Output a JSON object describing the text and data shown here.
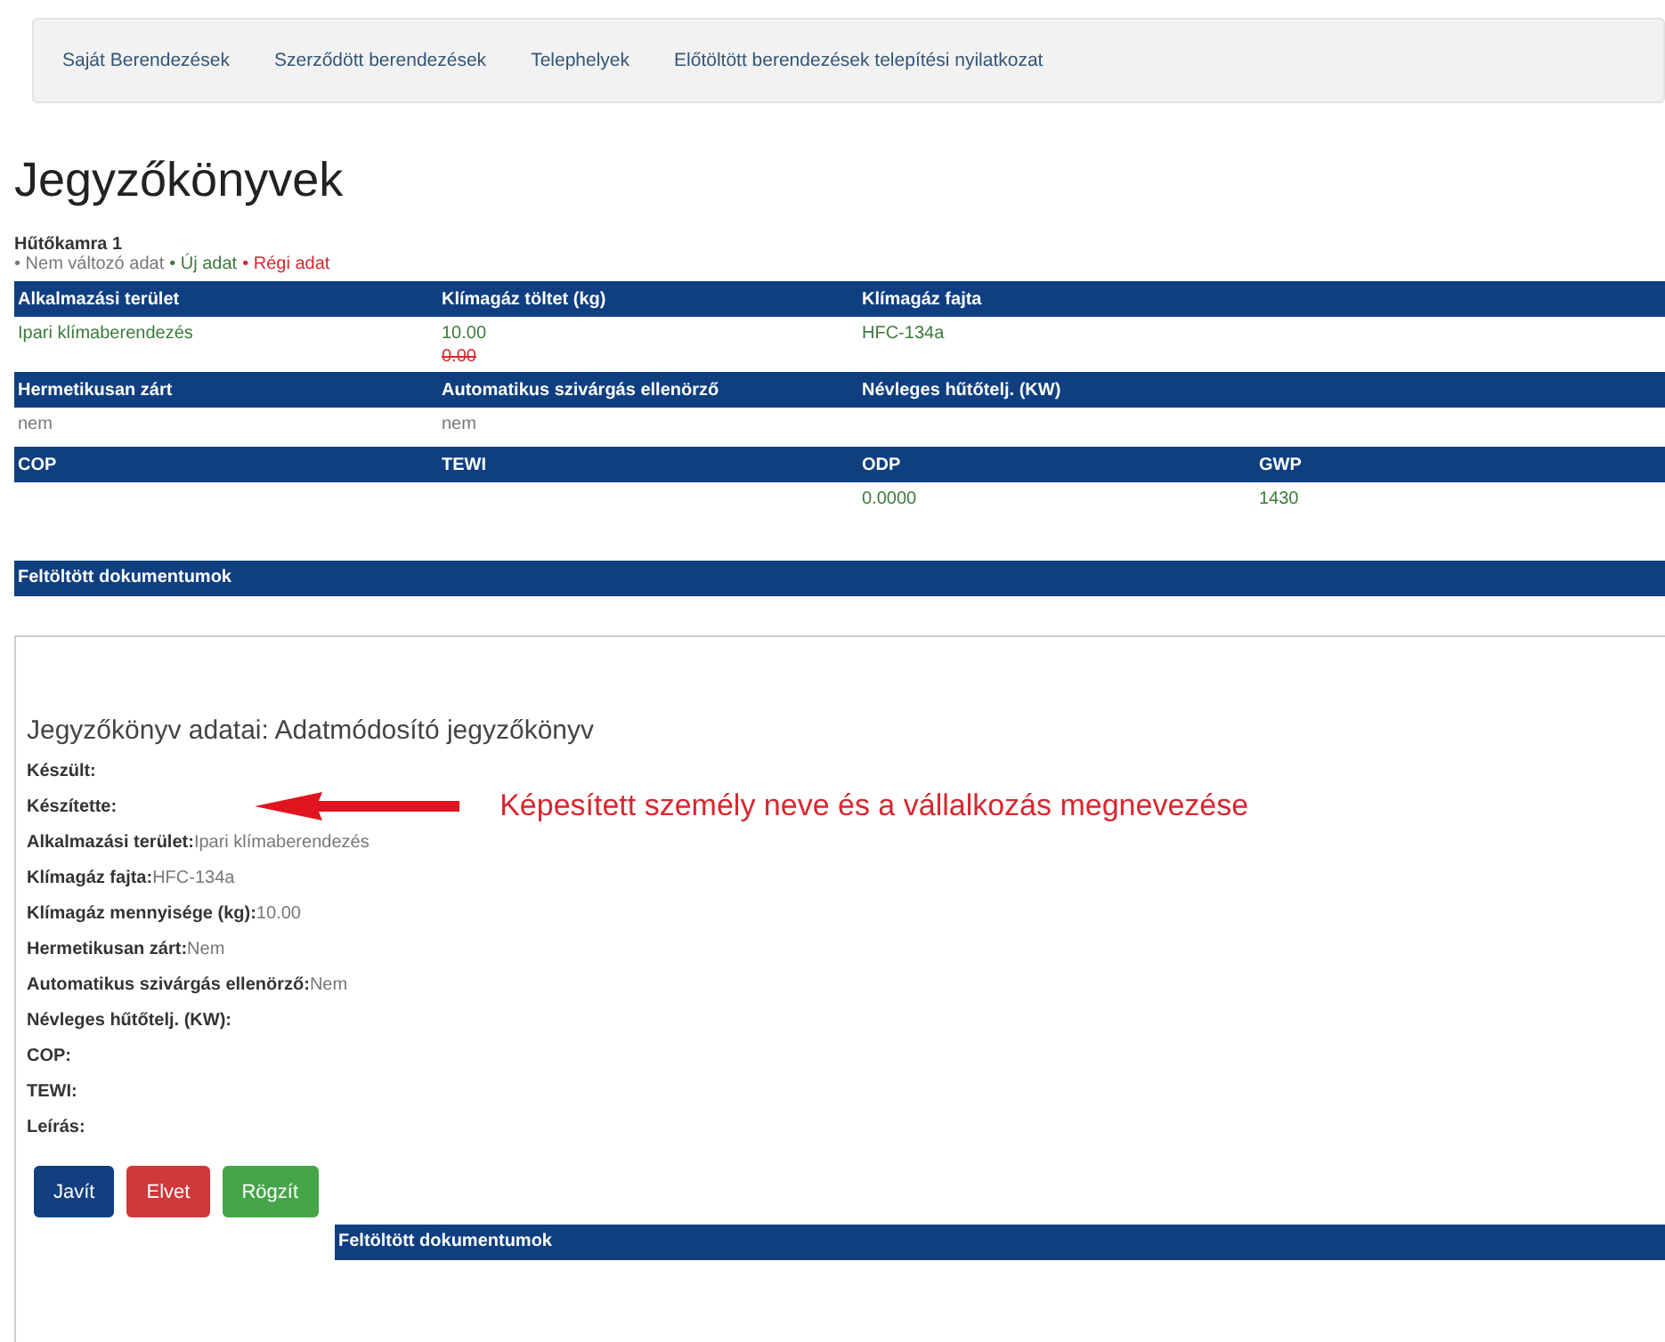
{
  "nav": {
    "items": [
      {
        "label": "Saját Berendezések"
      },
      {
        "label": "Szerződött berendezések"
      },
      {
        "label": "Telephelyek"
      },
      {
        "label": "Előtöltött berendezések telepítési nyilatkozat"
      }
    ]
  },
  "title": "Jegyzőkönyvek",
  "device_name": "Hűtőkamra 1",
  "legend": [
    {
      "label": "• Nem változó adat",
      "kind": "unchanged"
    },
    {
      "label": "• Új adat",
      "kind": "new"
    },
    {
      "label": "• Régi adat",
      "kind": "old"
    }
  ],
  "table_groups": [
    {
      "headers": [
        "Alkalmazási terület",
        "Klímagáz töltet (kg)",
        "Klímagáz fajta"
      ],
      "cells": [
        [
          {
            "text": "Ipari klímaberendezés",
            "kind": "new"
          }
        ],
        [
          {
            "text": "10.00",
            "kind": "new"
          },
          {
            "text": "0.00",
            "kind": "old"
          }
        ],
        [
          {
            "text": "HFC-134a",
            "kind": "new"
          }
        ],
        []
      ]
    },
    {
      "headers": [
        "Hermetikusan zárt",
        "Automatikus szivárgás ellenörző",
        "Névleges hűtőtelj. (KW)"
      ],
      "cells": [
        [
          {
            "text": "nem",
            "kind": "unchanged"
          }
        ],
        [
          {
            "text": "nem",
            "kind": "unchanged"
          }
        ],
        [],
        []
      ]
    },
    {
      "headers": [
        "COP",
        "TEWI",
        "ODP",
        "GWP"
      ],
      "cells": [
        [],
        [],
        [
          {
            "text": "0.0000",
            "kind": "new"
          }
        ],
        [
          {
            "text": "1430",
            "kind": "new"
          }
        ]
      ]
    }
  ],
  "documents_heading": "Feltöltött dokumentumok",
  "protocol": {
    "title": "Jegyzőkönyv adatai: Adatmódosító jegyzőkönyv",
    "fields": [
      {
        "label": "Készült:"
      },
      {
        "label": "Készítette:",
        "annotation": "Képesített személy neve és a vállalkozás megnevezése"
      },
      {
        "label": "Alkalmazási terület:",
        "value": "Ipari klímaberendezés"
      },
      {
        "label": "Klímagáz fajta:",
        "value": "HFC-134a"
      },
      {
        "label": "Klímagáz mennyisége (kg):",
        "value": "10.00"
      },
      {
        "label": "Hermetikusan zárt:",
        "value": "Nem"
      },
      {
        "label": "Automatikus szivárgás ellenörző:",
        "value": "Nem"
      },
      {
        "label": "Névleges hűtőtelj. (KW):"
      },
      {
        "label": "COP:"
      },
      {
        "label": "TEWI:"
      },
      {
        "label": "Leírás:"
      }
    ],
    "buttons": [
      {
        "label": "Javít",
        "kind": "primary"
      },
      {
        "label": "Elvet",
        "kind": "danger"
      },
      {
        "label": "Rögzít",
        "kind": "success"
      }
    ],
    "documents_heading": "Feltöltött dokumentumok"
  }
}
